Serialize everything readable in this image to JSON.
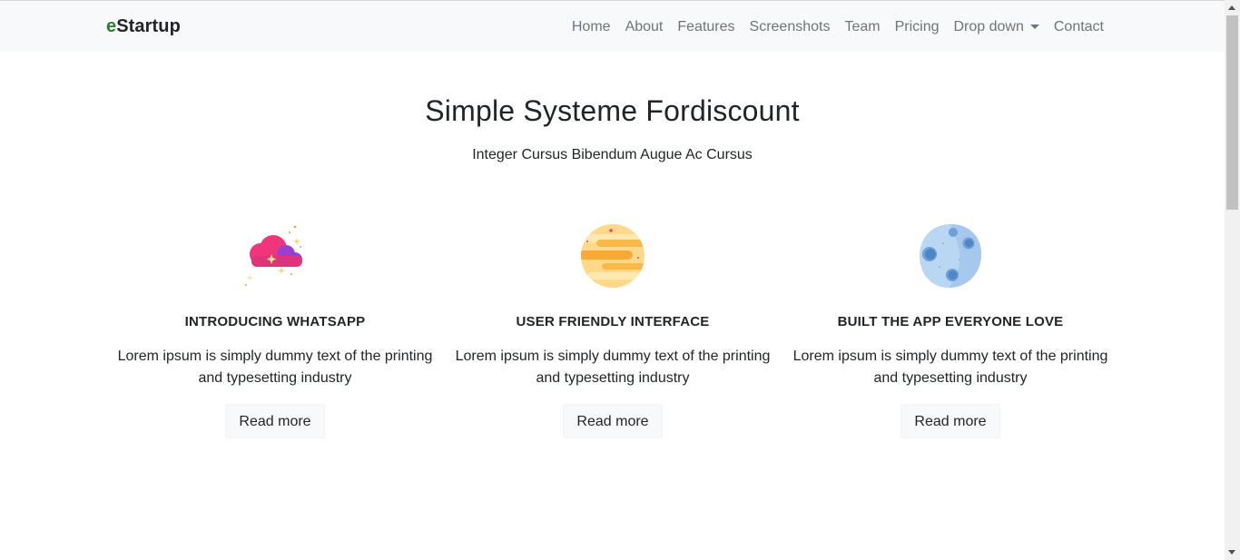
{
  "brand": {
    "prefix": "e",
    "name": "Startup"
  },
  "nav": {
    "items": [
      {
        "label": "Home"
      },
      {
        "label": "About"
      },
      {
        "label": "Features"
      },
      {
        "label": "Screenshots"
      },
      {
        "label": "Team"
      },
      {
        "label": "Pricing"
      },
      {
        "label": "Drop down"
      },
      {
        "label": "Contact"
      }
    ]
  },
  "hero": {
    "title": "Simple Systeme Fordiscount",
    "subtitle": "Integer Cursus Bibendum Augue Ac Cursus"
  },
  "features": [
    {
      "icon": "cloud-icon",
      "title": "INTRODUCING WHATSAPP",
      "text": "Lorem ipsum is simply dummy text of the printing and typesetting industry",
      "button": "Read more"
    },
    {
      "icon": "planet-icon",
      "title": "USER FRIENDLY INTERFACE",
      "text": "Lorem ipsum is simply dummy text of the printing and typesetting industry",
      "button": "Read more"
    },
    {
      "icon": "moon-icon",
      "title": "BUILT THE APP EVERYONE LOVE",
      "text": "Lorem ipsum is simply dummy text of the printing and typesetting industry",
      "button": "Read more"
    }
  ],
  "colors": {
    "navbar_bg": "#f8f9fa",
    "nav_link": "#6c757d",
    "brand_accent": "#2e7d32",
    "text": "#212529"
  }
}
